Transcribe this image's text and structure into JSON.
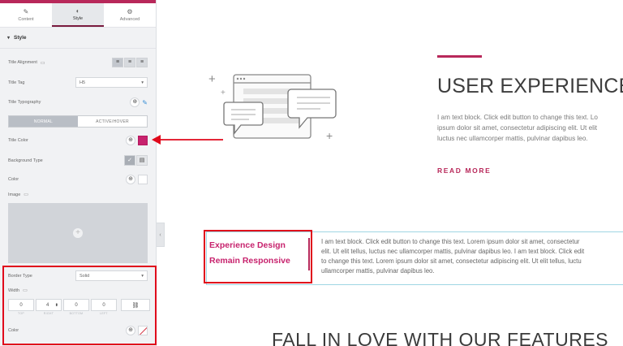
{
  "tabs": [
    {
      "label": "Content",
      "icon": "pencil-icon"
    },
    {
      "label": "Style",
      "icon": "half-circle-icon"
    },
    {
      "label": "Advanced",
      "icon": "gear-icon"
    }
  ],
  "section": {
    "title": "Style"
  },
  "controls": {
    "title_alignment": "Title Alignment",
    "title_tag": "Title Tag",
    "title_tag_value": "H5",
    "title_typography": "Title Typography",
    "state_normal": "NORMAL",
    "state_hover": "ACTIVE/HOVER",
    "title_color": "Title Color",
    "background_type": "Background Type",
    "color": "Color",
    "image": "Image",
    "border_type": "Border Type",
    "border_type_value": "Solid",
    "width": "Width",
    "width_values": {
      "top": "0",
      "right": "4",
      "bottom": "0",
      "left": "0"
    },
    "width_labels": {
      "top": "TOP",
      "right": "RIGHT",
      "bottom": "BOTTOM",
      "left": "LEFT"
    },
    "border_color": "Color"
  },
  "colors": {
    "title_color": "#c7226d",
    "accent": "#b8285a",
    "highlight": "#e0081b"
  },
  "hero": {
    "title": "USER EXPERIENCE",
    "text_lines": [
      "I am text block. Click edit button to change this text. Lo",
      "ipsum dolor sit amet, consectetur adipiscing elit. Ut elit",
      "luctus nec ullamcorper mattis, pulvinar dapibus leo."
    ],
    "read_more": "READ MORE"
  },
  "widget": {
    "title_line1": "Experience Design",
    "title_line2": "Remain Responsive",
    "text_lines": [
      "I am text block. Click edit button to change this text. Lorem ipsum dolor sit amet, consectetur",
      "elit. Ut elit tellus, luctus nec ullamcorper mattis, pulvinar dapibus leo. I am text block. Click edit",
      "to change this text. Lorem ipsum dolor sit amet, consectetur adipiscing elit. Ut elit tellus, luctu",
      "ullamcorper mattis, pulvinar dapibus leo."
    ]
  },
  "section2": {
    "title": "FALL IN LOVE WITH OUR FEATURES"
  }
}
